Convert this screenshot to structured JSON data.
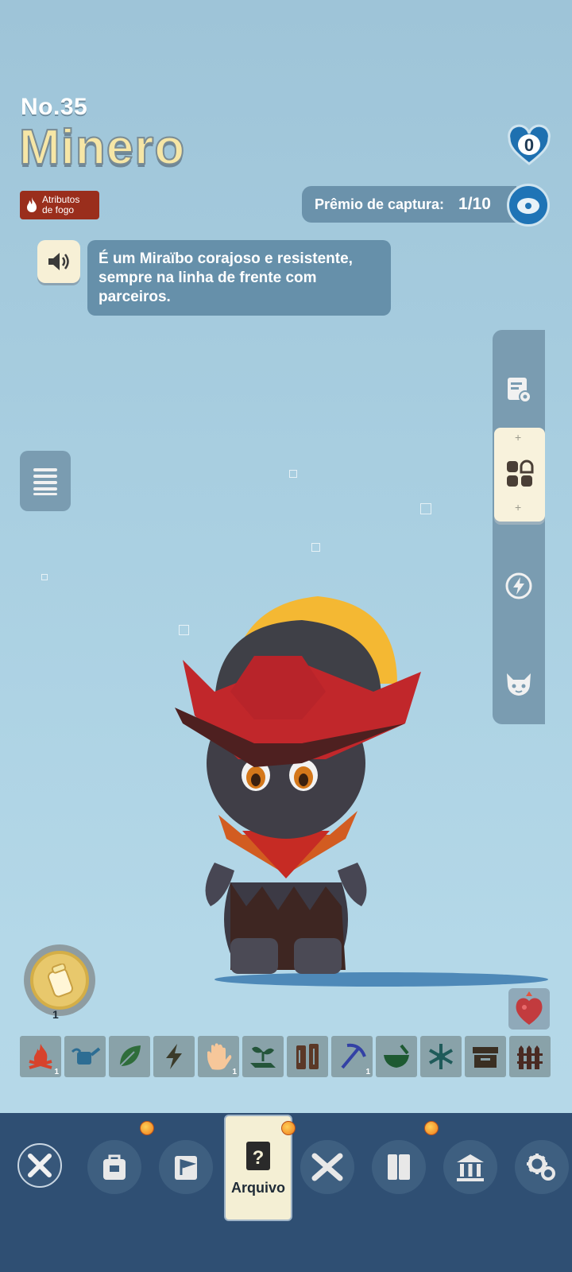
{
  "header": {
    "number": "No.35",
    "name": "Minero",
    "attribute_badge": "Atributos\nde fogo",
    "heart_count": "0",
    "capture_label": "Prêmio de captura:",
    "capture_value": "1/10"
  },
  "description": "É um Miraïbo corajoso e resistente, sempre na linha de frente com parceiros.",
  "side_menu": {
    "items": [
      "details-icon",
      "grid-icon",
      "energy-icon",
      "creature-face-icon"
    ],
    "active": "grid-icon"
  },
  "coin_count": "1",
  "tools": [
    {
      "icon": "campfire-icon",
      "count": "1"
    },
    {
      "icon": "watering-can-icon",
      "count": ""
    },
    {
      "icon": "leaf-icon",
      "count": ""
    },
    {
      "icon": "lightning-icon",
      "count": ""
    },
    {
      "icon": "hand-icon",
      "count": "1"
    },
    {
      "icon": "seedling-icon",
      "count": ""
    },
    {
      "icon": "log-icon",
      "count": ""
    },
    {
      "icon": "pickaxe-icon",
      "count": "1"
    },
    {
      "icon": "mortar-icon",
      "count": ""
    },
    {
      "icon": "snowflake-icon",
      "count": ""
    },
    {
      "icon": "box-icon",
      "count": ""
    },
    {
      "icon": "fence-icon",
      "count": ""
    }
  ],
  "bottom_nav": {
    "active_label": "Arquivo",
    "items": [
      "exit-icon",
      "backpack-icon",
      "flag-icon",
      "archive-icon",
      "cross-swords-icon",
      "book-icon",
      "museum-icon",
      "settings-icon"
    ]
  },
  "colors": {
    "accent_fire": "#9a2e1c",
    "panel": "#6690aa",
    "bottom_bar": "#2f4f73",
    "active_tab": "#f4efd4"
  }
}
